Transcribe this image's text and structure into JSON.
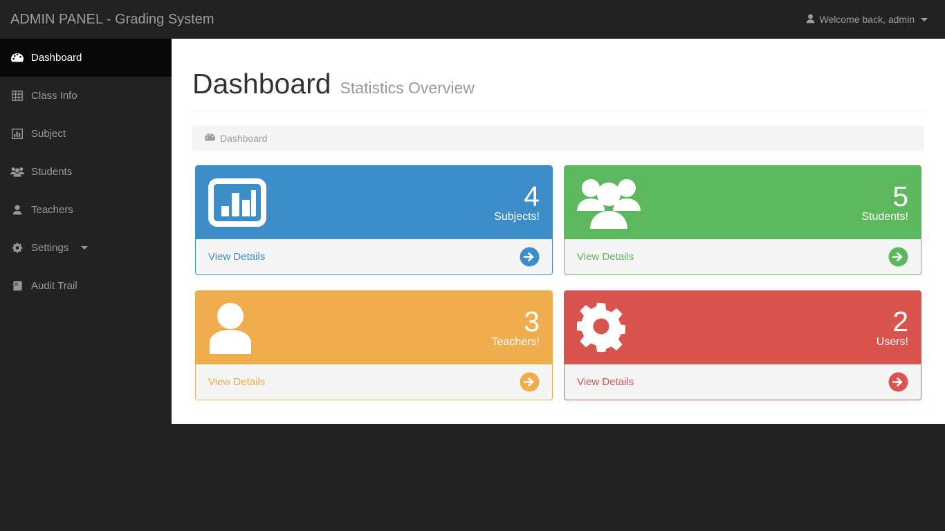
{
  "navbar": {
    "brand": "ADMIN PANEL - Grading System",
    "user_icon": "user-icon",
    "user_label": "Welcome back, admin",
    "caret_icon": "caret-down-icon"
  },
  "sidebar": {
    "items": [
      {
        "label": "Dashboard",
        "icon": "dashboard-icon",
        "active": true,
        "caret": false
      },
      {
        "label": "Class Info",
        "icon": "table-grid-icon",
        "active": false,
        "caret": false
      },
      {
        "label": "Subject",
        "icon": "bar-chart-icon",
        "active": false,
        "caret": false
      },
      {
        "label": "Students",
        "icon": "users-group-icon",
        "active": false,
        "caret": false
      },
      {
        "label": "Teachers",
        "icon": "user-icon",
        "active": false,
        "caret": false
      },
      {
        "label": "Settings",
        "icon": "gear-icon",
        "active": false,
        "caret": true
      },
      {
        "label": "Audit Trail",
        "icon": "book-icon",
        "active": false,
        "caret": false
      }
    ]
  },
  "page": {
    "title": "Dashboard",
    "subtitle": "Statistics Overview"
  },
  "breadcrumb": {
    "icon": "dashboard-icon",
    "label": "Dashboard"
  },
  "cards": [
    {
      "count": "4",
      "label": "Subjects!",
      "footer_label": "View Details",
      "icon": "bar-chart-icon",
      "arrow_icon": "arrow-circle-right-icon",
      "color": "#3c8dc8",
      "theme": "blue"
    },
    {
      "count": "5",
      "label": "Students!",
      "footer_label": "View Details",
      "icon": "users-group-icon",
      "arrow_icon": "arrow-circle-right-icon",
      "color": "#5cb85c",
      "theme": "green"
    },
    {
      "count": "3",
      "label": "Teachers!",
      "footer_label": "View Details",
      "icon": "user-icon",
      "arrow_icon": "arrow-circle-right-icon",
      "color": "#efad4e",
      "theme": "orange"
    },
    {
      "count": "2",
      "label": "Users!",
      "footer_label": "View Details",
      "icon": "gear-icon",
      "arrow_icon": "arrow-circle-right-icon",
      "color": "#d9534f",
      "theme": "red"
    }
  ]
}
